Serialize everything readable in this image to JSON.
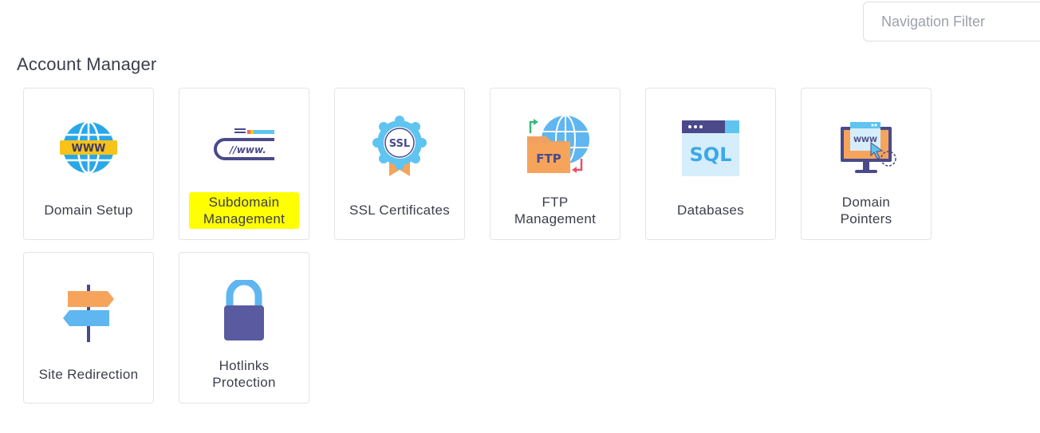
{
  "header": {
    "filter_placeholder": "Navigation Filter"
  },
  "section": {
    "title": "Account Manager"
  },
  "cards": [
    {
      "label": "Domain Setup",
      "icon": "globe-www-icon"
    },
    {
      "label": "Subdomain Management",
      "icon": "www-address-bar-icon",
      "highlighted": true,
      "highlight_color": "#ffff00"
    },
    {
      "label": "SSL Certificates",
      "icon": "ssl-badge-icon"
    },
    {
      "label": "FTP Management",
      "icon": "ftp-folder-globe-icon"
    },
    {
      "label": "Databases",
      "icon": "sql-window-icon"
    },
    {
      "label": "Domain Pointers",
      "icon": "monitor-www-pointer-icon"
    },
    {
      "label": "Site Redirection",
      "icon": "signpost-icon"
    },
    {
      "label": "Hotlinks Protection",
      "icon": "padlock-icon"
    }
  ]
}
